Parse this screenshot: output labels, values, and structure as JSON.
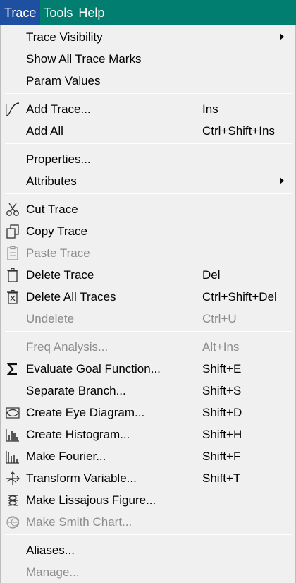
{
  "menubar": {
    "items": [
      {
        "label": "Trace"
      },
      {
        "label": "Tools"
      },
      {
        "label": "Help"
      }
    ]
  },
  "menu": {
    "items": [
      {
        "label": "Trace Visibility",
        "shortcut": "",
        "submenu": true,
        "disabled": false,
        "icon": ""
      },
      {
        "label": "Show All Trace Marks",
        "shortcut": "",
        "submenu": false,
        "disabled": false,
        "icon": ""
      },
      {
        "label": "Param Values",
        "shortcut": "",
        "submenu": false,
        "disabled": false,
        "icon": ""
      },
      {
        "label": "Add Trace...",
        "shortcut": "Ins",
        "submenu": false,
        "disabled": false,
        "icon": "add-trace-icon"
      },
      {
        "label": "Add All",
        "shortcut": "Ctrl+Shift+Ins",
        "submenu": false,
        "disabled": false,
        "icon": ""
      },
      {
        "label": "Properties...",
        "shortcut": "",
        "submenu": false,
        "disabled": false,
        "icon": ""
      },
      {
        "label": "Attributes",
        "shortcut": "",
        "submenu": true,
        "disabled": false,
        "icon": ""
      },
      {
        "label": "Cut Trace",
        "shortcut": "",
        "submenu": false,
        "disabled": false,
        "icon": "scissors-icon"
      },
      {
        "label": "Copy Trace",
        "shortcut": "",
        "submenu": false,
        "disabled": false,
        "icon": "copy-icon"
      },
      {
        "label": "Paste Trace",
        "shortcut": "",
        "submenu": false,
        "disabled": true,
        "icon": "clipboard-icon"
      },
      {
        "label": "Delete Trace",
        "shortcut": "Del",
        "submenu": false,
        "disabled": false,
        "icon": "trash-icon"
      },
      {
        "label": "Delete All Traces",
        "shortcut": "Ctrl+Shift+Del",
        "submenu": false,
        "disabled": false,
        "icon": "delete-all-icon"
      },
      {
        "label": "Undelete",
        "shortcut": "Ctrl+U",
        "submenu": false,
        "disabled": true,
        "icon": ""
      },
      {
        "label": "Freq Analysis...",
        "shortcut": "Alt+Ins",
        "submenu": false,
        "disabled": true,
        "icon": ""
      },
      {
        "label": "Evaluate Goal Function...",
        "shortcut": "Shift+E",
        "submenu": false,
        "disabled": false,
        "icon": "sigma-icon"
      },
      {
        "label": "Separate Branch...",
        "shortcut": "Shift+S",
        "submenu": false,
        "disabled": false,
        "icon": ""
      },
      {
        "label": "Create Eye Diagram...",
        "shortcut": "Shift+D",
        "submenu": false,
        "disabled": false,
        "icon": "eye-diagram-icon"
      },
      {
        "label": "Create Histogram...",
        "shortcut": "Shift+H",
        "submenu": false,
        "disabled": false,
        "icon": "histogram-icon"
      },
      {
        "label": "Make Fourier...",
        "shortcut": "Shift+F",
        "submenu": false,
        "disabled": false,
        "icon": "fourier-icon"
      },
      {
        "label": "Transform Variable...",
        "shortcut": "Shift+T",
        "submenu": false,
        "disabled": false,
        "icon": "transform-icon"
      },
      {
        "label": "Make Lissajous Figure...",
        "shortcut": "",
        "submenu": false,
        "disabled": false,
        "icon": "lissajous-icon"
      },
      {
        "label": "Make Smith Chart...",
        "shortcut": "",
        "submenu": false,
        "disabled": true,
        "icon": "smith-chart-icon"
      },
      {
        "label": "Aliases...",
        "shortcut": "",
        "submenu": false,
        "disabled": false,
        "icon": ""
      },
      {
        "label": "Manage...",
        "shortcut": "",
        "submenu": false,
        "disabled": true,
        "icon": ""
      }
    ]
  },
  "colors": {
    "menubar_bg": "#017e6f",
    "active_menu_bg": "#1f4fa0",
    "menu_bg": "#f0f0f0",
    "disabled_text": "#8c8c8c"
  }
}
